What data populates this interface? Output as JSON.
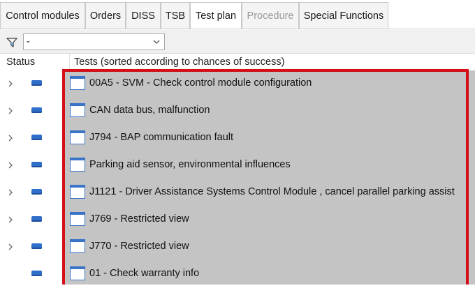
{
  "tabs": [
    {
      "label": "Control modules",
      "state": "normal"
    },
    {
      "label": "Orders",
      "state": "normal"
    },
    {
      "label": "DISS",
      "state": "normal"
    },
    {
      "label": "TSB",
      "state": "normal"
    },
    {
      "label": "Test plan",
      "state": "active"
    },
    {
      "label": "Procedure",
      "state": "disabled"
    },
    {
      "label": "Special Functions",
      "state": "normal"
    }
  ],
  "filter": {
    "selected": "-"
  },
  "columns": {
    "status": "Status",
    "tests": "Tests (sorted according to chances of success)"
  },
  "tests": [
    {
      "label": "00A5 - SVM - Check control module configuration",
      "expandable": true
    },
    {
      "label": "CAN data bus, malfunction",
      "expandable": true
    },
    {
      "label": "J794 - BAP communication fault",
      "expandable": true
    },
    {
      "label": "Parking aid sensor, environmental influences",
      "expandable": true
    },
    {
      "label": "J1121 - Driver Assistance Systems Control Module , cancel parallel parking assist",
      "expandable": true
    },
    {
      "label": "J769 - Restricted view",
      "expandable": true
    },
    {
      "label": "J770 - Restricted view",
      "expandable": true
    },
    {
      "label": "01 - Check warranty info",
      "expandable": false
    }
  ],
  "colors": {
    "highlight_border": "#d30f17",
    "list_background": "#c4c4c4",
    "status_indicator": "#2f6ec9"
  }
}
